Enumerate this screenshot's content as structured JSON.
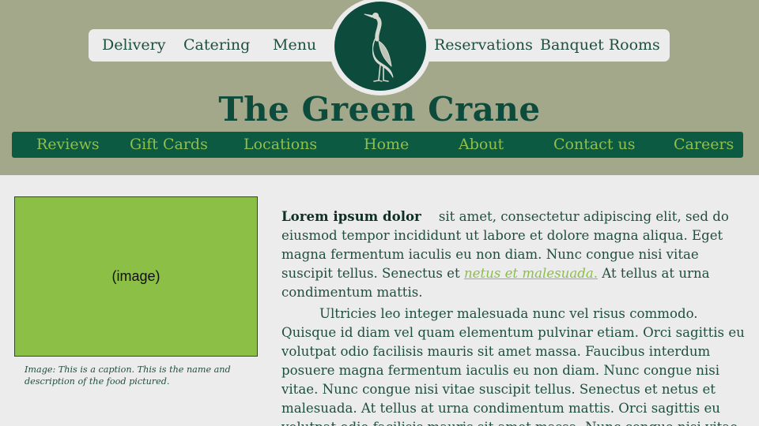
{
  "top_nav": {
    "left_links": [
      "Delivery",
      "Catering",
      "Menu"
    ],
    "right_links": [
      "Reservations",
      "Banquet Rooms"
    ]
  },
  "logo": {
    "icon": "crane-icon"
  },
  "site_title": "The Green Crane",
  "main_nav": [
    "Reviews",
    "Gift Cards",
    "Locations",
    "Home",
    "About",
    "Contact us",
    "Careers"
  ],
  "image": {
    "placeholder": "(image)",
    "caption": "Image: This is a caption. This is the name and description of the food pictured."
  },
  "article": {
    "lead": "Lorem ipsum dolor",
    "p1_before_link": "sit amet, consectetur adipiscing elit, sed do eiusmod tempor incididunt ut labore et dolore magna aliqua. Eget magna fermentum iaculis eu non diam. Nunc congue nisi vitae suscipit tellus. Senectus et ",
    "link_text": "netus et malesuada.",
    "p1_after_link": " At tellus at urna condimentum mattis.",
    "p2": "Ultricies leo integer malesuada nunc vel risus commodo. Quisque id diam vel quam elementum pulvinar etiam. Orci sagittis eu volutpat odio facilisis mauris sit amet massa. Faucibus interdum posuere magna fermentum iaculis eu non diam. Nunc congue nisi vitae. Nunc congue nisi vitae suscipit tellus. Senectus et netus et malesuada. At tellus at urna condimentum mattis. Orci sagittis eu volutpat odio facilisis mauris sit amet massa. Nunc congue nisi vitae"
  },
  "colors": {
    "header_bg": "#a2a889",
    "brand_green": "#0d4c3c",
    "nav_bar": "#0d5a42",
    "accent_lime": "#8cbf45",
    "page_bg": "#ececec"
  }
}
